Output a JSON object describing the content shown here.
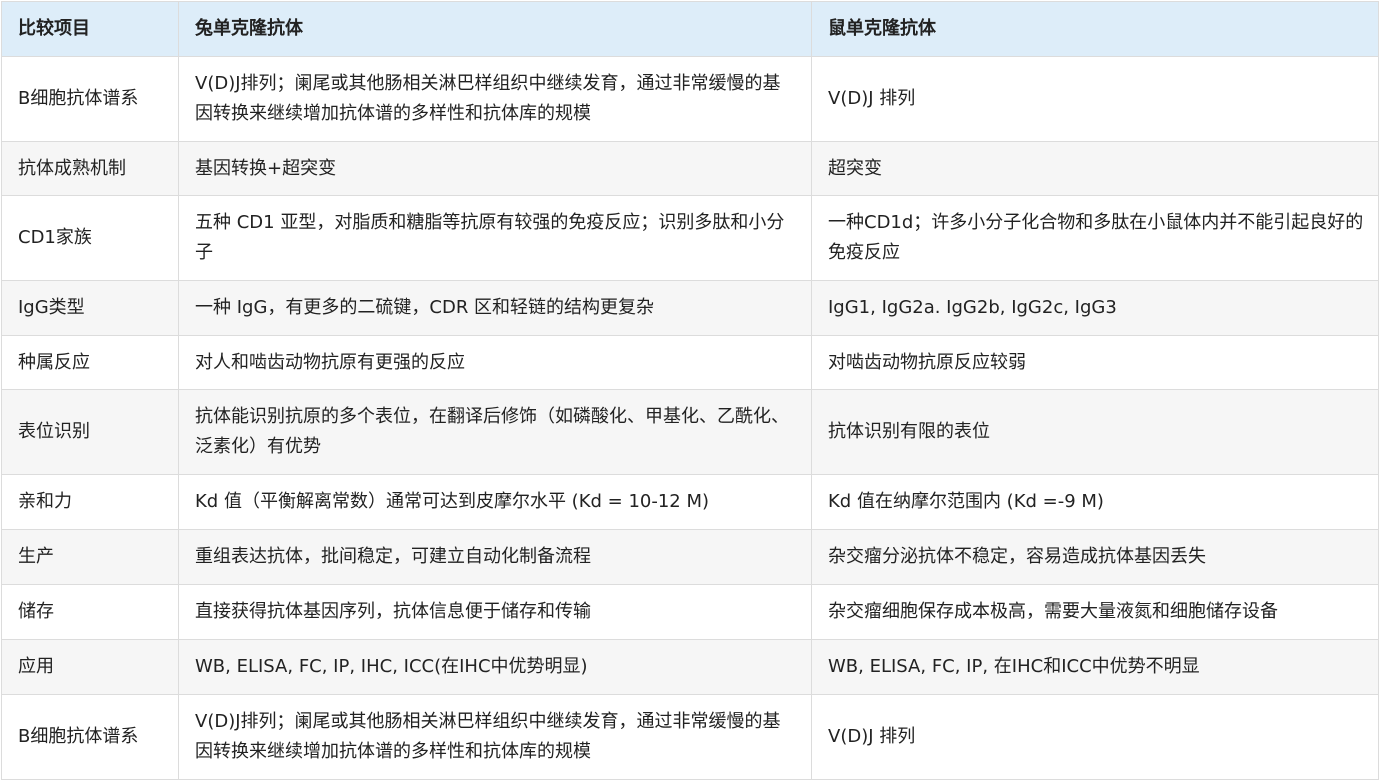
{
  "header": [
    "比较项目",
    "兔单克隆抗体",
    "鼠单克隆抗体"
  ],
  "rows": [
    [
      "B细胞抗体谱系",
      "V(D)J排列；阑尾或其他肠相关淋巴样组织中继续发育，通过非常缓慢的基因转换来继续增加抗体谱的多样性和抗体库的规模",
      "V(D)J 排列"
    ],
    [
      "抗体成熟机制",
      "基因转换+超突变",
      "超突变"
    ],
    [
      "CD1家族",
      "五种 CD1 亚型，对脂质和糖脂等抗原有较强的免疫反应；识别多肽和小分子",
      "一种CD1d；许多小分子化合物和多肽在小鼠体内并不能引起良好的免疫反应"
    ],
    [
      "IgG类型",
      "一种 IgG，有更多的二硫键，CDR 区和轻链的结构更复杂",
      "IgG1, IgG2a. IgG2b, IgG2c, IgG3"
    ],
    [
      "种属反应",
      "对人和啮齿动物抗原有更强的反应",
      "对啮齿动物抗原反应较弱"
    ],
    [
      "表位识别",
      "抗体能识别抗原的多个表位，在翻译后修饰（如磷酸化、甲基化、乙酰化、泛素化）有优势",
      "抗体识别有限的表位"
    ],
    [
      "亲和力",
      "Kd 值（平衡解离常数）通常可达到皮摩尔水平 (Kd = 10-12 M)",
      "Kd 值在纳摩尔范围内 (Kd =-9 M)"
    ],
    [
      "生产",
      "重组表达抗体，批间稳定，可建立自动化制备流程",
      "杂交瘤分泌抗体不稳定，容易造成抗体基因丢失"
    ],
    [
      "储存",
      "直接获得抗体基因序列，抗体信息便于储存和传输",
      "杂交瘤细胞保存成本极高，需要大量液氮和细胞储存设备"
    ],
    [
      "应用",
      "WB, ELISA, FC, IP, IHC, ICC(在IHC中优势明显)",
      "WB, ELISA, FC, IP, 在IHC和ICC中优势不明显"
    ],
    [
      "B细胞抗体谱系",
      "V(D)J排列；阑尾或其他肠相关淋巴样组织中继续发育，通过非常缓慢的基因转换来继续增加抗体谱的多样性和抗体库的规模",
      "V(D)J 排列"
    ]
  ]
}
